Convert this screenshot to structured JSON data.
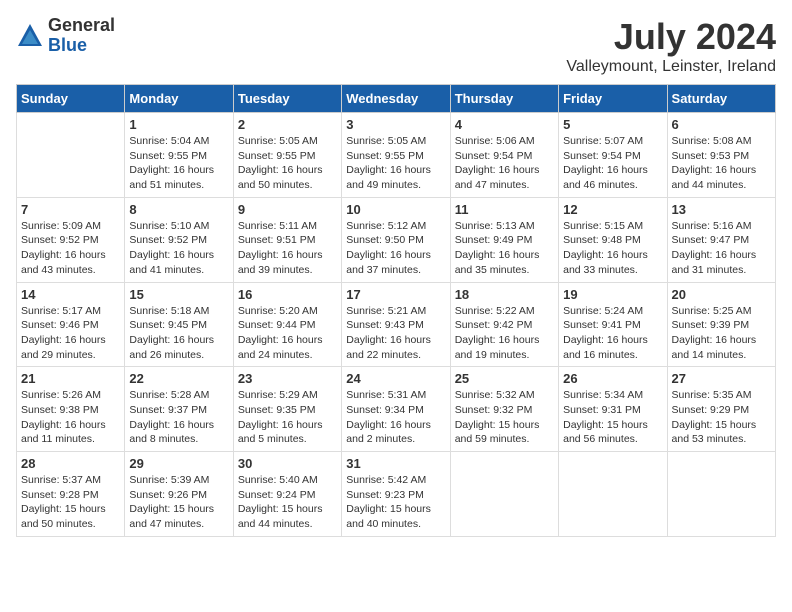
{
  "logo": {
    "general": "General",
    "blue": "Blue"
  },
  "title": "July 2024",
  "location": "Valleymount, Leinster, Ireland",
  "days_header": [
    "Sunday",
    "Monday",
    "Tuesday",
    "Wednesday",
    "Thursday",
    "Friday",
    "Saturday"
  ],
  "weeks": [
    [
      {
        "day": "",
        "info": ""
      },
      {
        "day": "1",
        "info": "Sunrise: 5:04 AM\nSunset: 9:55 PM\nDaylight: 16 hours\nand 51 minutes."
      },
      {
        "day": "2",
        "info": "Sunrise: 5:05 AM\nSunset: 9:55 PM\nDaylight: 16 hours\nand 50 minutes."
      },
      {
        "day": "3",
        "info": "Sunrise: 5:05 AM\nSunset: 9:55 PM\nDaylight: 16 hours\nand 49 minutes."
      },
      {
        "day": "4",
        "info": "Sunrise: 5:06 AM\nSunset: 9:54 PM\nDaylight: 16 hours\nand 47 minutes."
      },
      {
        "day": "5",
        "info": "Sunrise: 5:07 AM\nSunset: 9:54 PM\nDaylight: 16 hours\nand 46 minutes."
      },
      {
        "day": "6",
        "info": "Sunrise: 5:08 AM\nSunset: 9:53 PM\nDaylight: 16 hours\nand 44 minutes."
      }
    ],
    [
      {
        "day": "7",
        "info": "Sunrise: 5:09 AM\nSunset: 9:52 PM\nDaylight: 16 hours\nand 43 minutes."
      },
      {
        "day": "8",
        "info": "Sunrise: 5:10 AM\nSunset: 9:52 PM\nDaylight: 16 hours\nand 41 minutes."
      },
      {
        "day": "9",
        "info": "Sunrise: 5:11 AM\nSunset: 9:51 PM\nDaylight: 16 hours\nand 39 minutes."
      },
      {
        "day": "10",
        "info": "Sunrise: 5:12 AM\nSunset: 9:50 PM\nDaylight: 16 hours\nand 37 minutes."
      },
      {
        "day": "11",
        "info": "Sunrise: 5:13 AM\nSunset: 9:49 PM\nDaylight: 16 hours\nand 35 minutes."
      },
      {
        "day": "12",
        "info": "Sunrise: 5:15 AM\nSunset: 9:48 PM\nDaylight: 16 hours\nand 33 minutes."
      },
      {
        "day": "13",
        "info": "Sunrise: 5:16 AM\nSunset: 9:47 PM\nDaylight: 16 hours\nand 31 minutes."
      }
    ],
    [
      {
        "day": "14",
        "info": "Sunrise: 5:17 AM\nSunset: 9:46 PM\nDaylight: 16 hours\nand 29 minutes."
      },
      {
        "day": "15",
        "info": "Sunrise: 5:18 AM\nSunset: 9:45 PM\nDaylight: 16 hours\nand 26 minutes."
      },
      {
        "day": "16",
        "info": "Sunrise: 5:20 AM\nSunset: 9:44 PM\nDaylight: 16 hours\nand 24 minutes."
      },
      {
        "day": "17",
        "info": "Sunrise: 5:21 AM\nSunset: 9:43 PM\nDaylight: 16 hours\nand 22 minutes."
      },
      {
        "day": "18",
        "info": "Sunrise: 5:22 AM\nSunset: 9:42 PM\nDaylight: 16 hours\nand 19 minutes."
      },
      {
        "day": "19",
        "info": "Sunrise: 5:24 AM\nSunset: 9:41 PM\nDaylight: 16 hours\nand 16 minutes."
      },
      {
        "day": "20",
        "info": "Sunrise: 5:25 AM\nSunset: 9:39 PM\nDaylight: 16 hours\nand 14 minutes."
      }
    ],
    [
      {
        "day": "21",
        "info": "Sunrise: 5:26 AM\nSunset: 9:38 PM\nDaylight: 16 hours\nand 11 minutes."
      },
      {
        "day": "22",
        "info": "Sunrise: 5:28 AM\nSunset: 9:37 PM\nDaylight: 16 hours\nand 8 minutes."
      },
      {
        "day": "23",
        "info": "Sunrise: 5:29 AM\nSunset: 9:35 PM\nDaylight: 16 hours\nand 5 minutes."
      },
      {
        "day": "24",
        "info": "Sunrise: 5:31 AM\nSunset: 9:34 PM\nDaylight: 16 hours\nand 2 minutes."
      },
      {
        "day": "25",
        "info": "Sunrise: 5:32 AM\nSunset: 9:32 PM\nDaylight: 15 hours\nand 59 minutes."
      },
      {
        "day": "26",
        "info": "Sunrise: 5:34 AM\nSunset: 9:31 PM\nDaylight: 15 hours\nand 56 minutes."
      },
      {
        "day": "27",
        "info": "Sunrise: 5:35 AM\nSunset: 9:29 PM\nDaylight: 15 hours\nand 53 minutes."
      }
    ],
    [
      {
        "day": "28",
        "info": "Sunrise: 5:37 AM\nSunset: 9:28 PM\nDaylight: 15 hours\nand 50 minutes."
      },
      {
        "day": "29",
        "info": "Sunrise: 5:39 AM\nSunset: 9:26 PM\nDaylight: 15 hours\nand 47 minutes."
      },
      {
        "day": "30",
        "info": "Sunrise: 5:40 AM\nSunset: 9:24 PM\nDaylight: 15 hours\nand 44 minutes."
      },
      {
        "day": "31",
        "info": "Sunrise: 5:42 AM\nSunset: 9:23 PM\nDaylight: 15 hours\nand 40 minutes."
      },
      {
        "day": "",
        "info": ""
      },
      {
        "day": "",
        "info": ""
      },
      {
        "day": "",
        "info": ""
      }
    ]
  ]
}
